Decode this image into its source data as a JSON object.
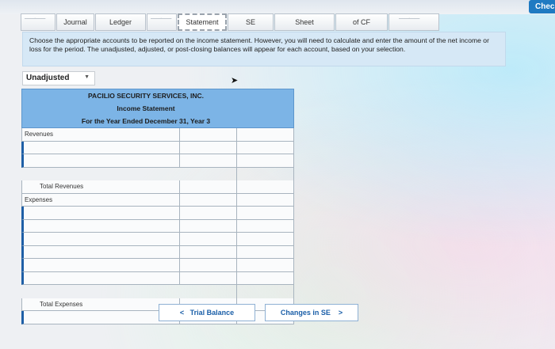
{
  "tabs": [
    {
      "label": "Journal"
    },
    {
      "label": "Ledger"
    },
    {
      "label": "Statement",
      "active": true
    },
    {
      "label": "SE"
    },
    {
      "label": "Sheet"
    },
    {
      "label": "of CF"
    }
  ],
  "check_button": "Chec",
  "instructions": "Choose the appropriate accounts to be reported on the income statement. However, you will need to calculate and enter the amount of the net income or loss for the period. The unadjusted, adjusted, or post-closing balances will appear for each account, based on your selection.",
  "view_select": {
    "value": "Unadjusted"
  },
  "statement": {
    "company": "PACILIO SECURITY SERVICES, INC.",
    "title": "Income Statement",
    "period": "For the Year Ended December 31, Year 3",
    "revenues_label": "Revenues",
    "total_revenues_label": "Total Revenues",
    "expenses_label": "Expenses",
    "total_expenses_label": "Total Expenses"
  },
  "nav": {
    "prev_label": "Trial Balance",
    "next_label": "Changes in SE",
    "prev_arrow": "<",
    "next_arrow": ">"
  }
}
